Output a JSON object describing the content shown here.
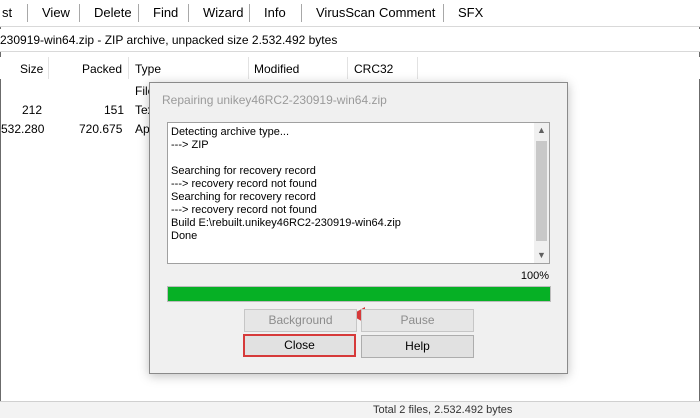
{
  "menubar": {
    "items": [
      "st",
      "View",
      "Delete",
      "Find",
      "Wizard",
      "Info",
      "VirusScan",
      "Comment",
      "SFX"
    ]
  },
  "path": {
    "text": "230919-win64.zip - ZIP archive, unpacked size 2.532.492 bytes"
  },
  "file_list": {
    "columns": [
      "Size",
      "Packed",
      "Type",
      "Modified",
      "CRC32"
    ],
    "rows": [
      {
        "size": "",
        "packed": "",
        "type": "File"
      },
      {
        "size": "212",
        "packed": "151",
        "type": "Tex"
      },
      {
        "size": "532.280",
        "packed": "720.675",
        "type": "Ap"
      }
    ]
  },
  "dialog": {
    "title": "Repairing unikey46RC2-230919-win64.zip",
    "log_lines": [
      "Detecting archive type...",
      "---> ZIP",
      "",
      "Searching for recovery record",
      "---> recovery record not found",
      "Searching for recovery record",
      "---> recovery record not found",
      "Build E:\\rebuilt.unikey46RC2-230919-win64.zip",
      "Done"
    ],
    "progress_percent_label": "100%",
    "progress_fraction": 1.0,
    "progress_color": "#06b025",
    "buttons": {
      "background": "Background",
      "pause": "Pause",
      "close": "Close",
      "help": "Help"
    },
    "highlight_color": "#d63a3a"
  },
  "status_bar": {
    "text": "Total 2 files, 2.532.492 bytes"
  }
}
